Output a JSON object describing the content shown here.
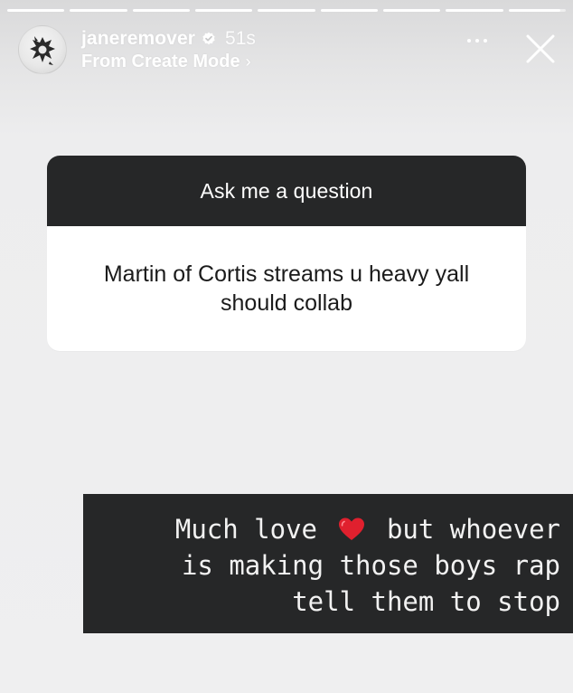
{
  "story": {
    "progress": [
      1,
      1,
      1,
      1,
      1,
      1,
      1,
      1,
      0.9
    ]
  },
  "header": {
    "username": "janeremover",
    "time": "51s",
    "subtitle": "From Create Mode",
    "subtitle_chevron": "›",
    "verified_icon": "verified-badge-icon",
    "more_icon": "more-horizontal-icon",
    "close_icon": "close-icon"
  },
  "question": {
    "prompt": "Ask me a question",
    "text": "Martin of Cortis streams u heavy yall should collab"
  },
  "reply": {
    "line1_before": "Much love",
    "line1_after": "but whoever",
    "line2": "is making those boys rap",
    "line3": "tell them to stop",
    "emoji_icon": "red-heart-icon"
  }
}
